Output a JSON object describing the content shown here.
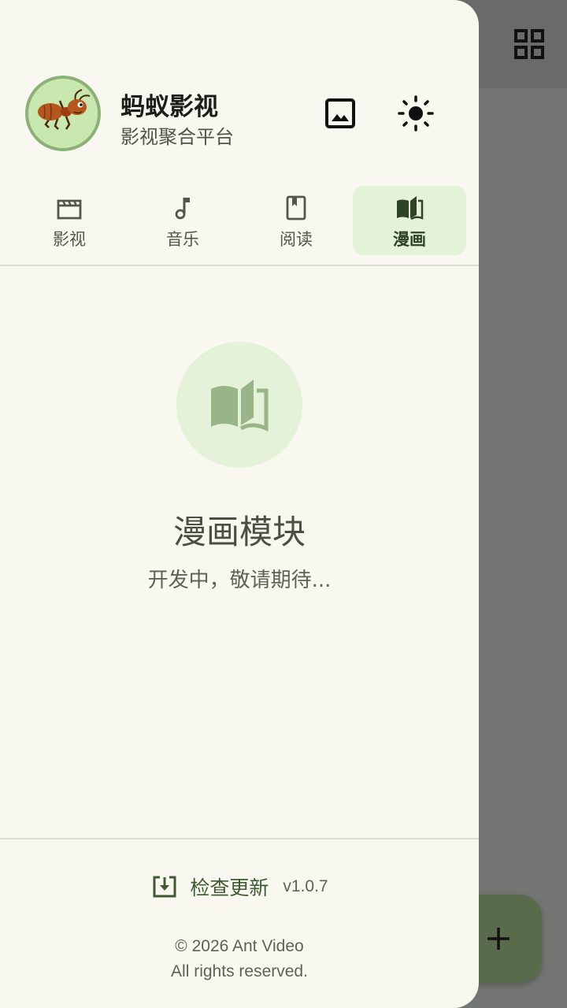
{
  "header": {
    "title": "蚂蚁影视",
    "subtitle": "影视聚合平台",
    "avatar_icon": "ant-logo",
    "actions": [
      {
        "icon": "image-icon"
      },
      {
        "icon": "sun-icon"
      }
    ]
  },
  "tabs": [
    {
      "label": "影视",
      "icon": "movie-clapper-icon",
      "active": false
    },
    {
      "label": "音乐",
      "icon": "music-note-icon",
      "active": false
    },
    {
      "label": "阅读",
      "icon": "book-icon",
      "active": false
    },
    {
      "label": "漫画",
      "icon": "open-book-icon",
      "active": true
    }
  ],
  "empty_state": {
    "icon": "open-book-icon",
    "title": "漫画模块",
    "subtitle": "开发中，敬请期待..."
  },
  "footer": {
    "update_label": "检查更新",
    "version": "v1.0.7",
    "copyright_line1": "© 2026 Ant Video",
    "copyright_line2": "All rights reserved."
  },
  "background": {
    "grid_icon": "grid-view-icon",
    "fab_icon": "plus-icon"
  },
  "colors": {
    "drawer_bg": "#f8f8f0",
    "accent": "#3f5a31",
    "active_tab_bg": "#e3f2d8",
    "fab_bg": "#586b4b",
    "scrim": "#747673"
  }
}
